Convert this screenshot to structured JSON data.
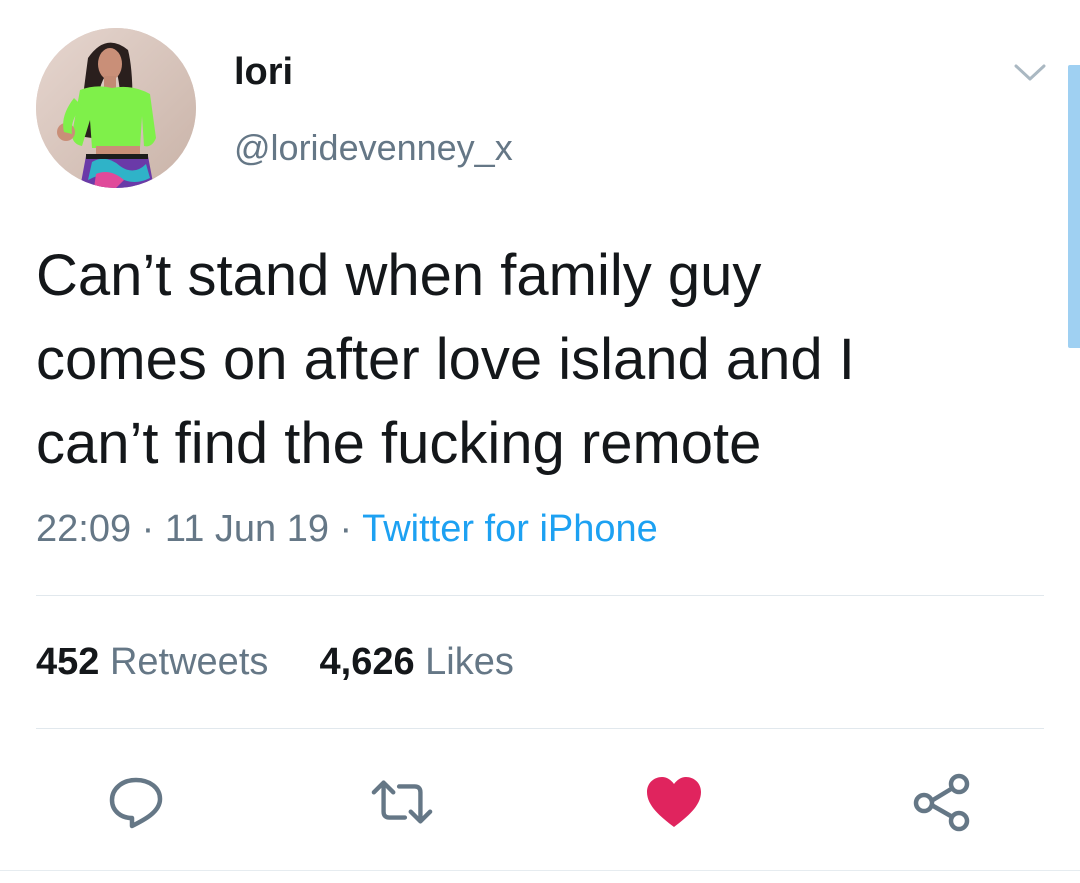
{
  "tweet": {
    "display_name": "lori",
    "handle": "@loridevenney_x",
    "text_lines": [
      "Can’t stand when family guy",
      "comes on after love island and I",
      "can’t find the fucking remote"
    ],
    "time": "22:09",
    "date": "11 Jun 19",
    "separator": "·",
    "source": "Twitter for iPhone"
  },
  "stats": {
    "retweets_count": "452",
    "retweets_label": "Retweets",
    "likes_count": "4,626",
    "likes_label": "Likes"
  },
  "actions": {
    "reply_icon": "reply-icon",
    "retweet_icon": "retweet-icon",
    "like_icon": "heart-icon",
    "share_icon": "share-icon",
    "liked": true
  },
  "colors": {
    "accent": "#1da1f2",
    "like": "#e0245e",
    "secondary_text": "#657786",
    "primary_text": "#14171a",
    "scrollbar": "#9fd0f2"
  }
}
